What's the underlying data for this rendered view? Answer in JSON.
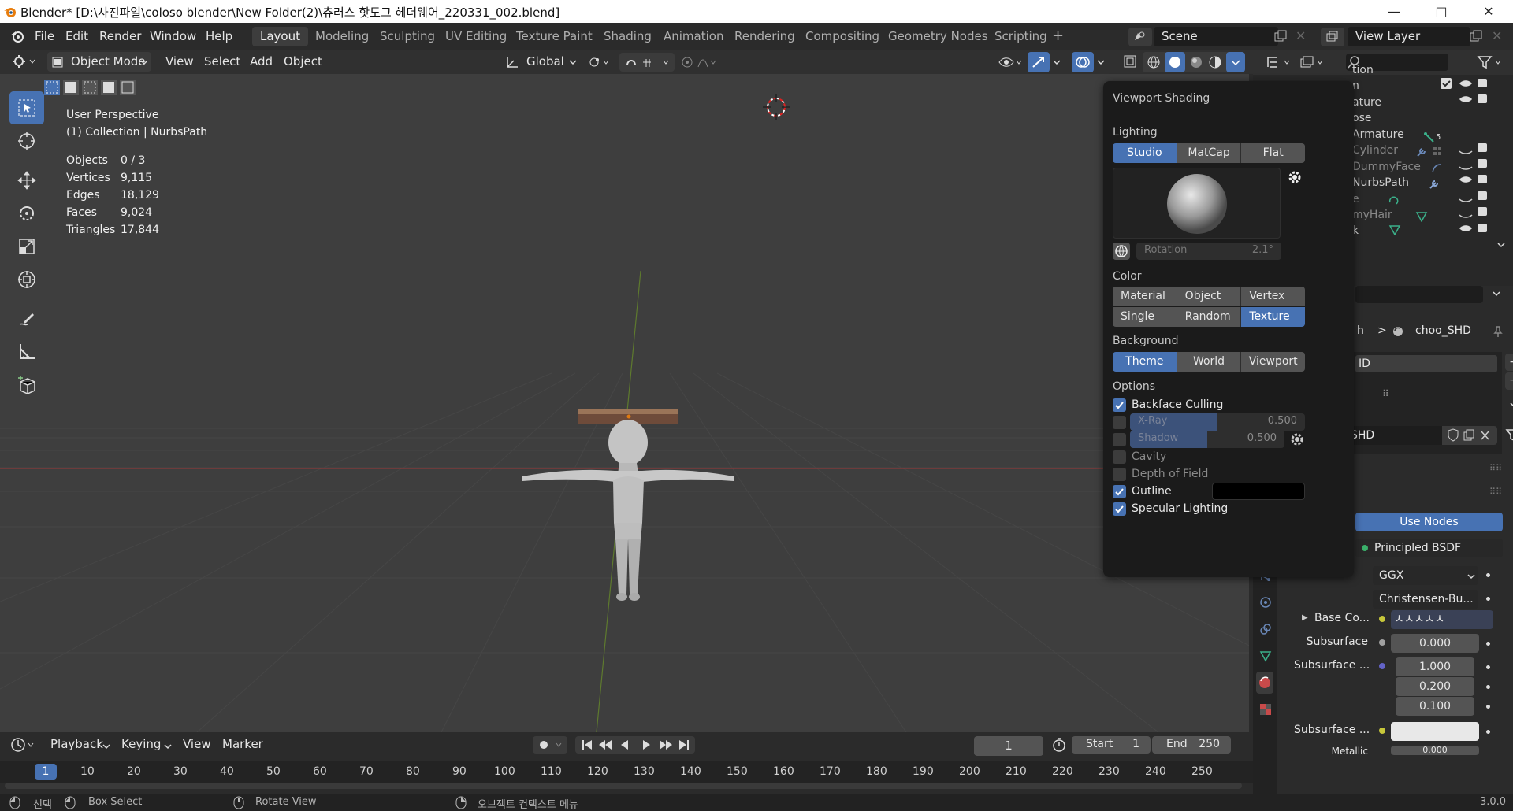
{
  "window": {
    "title": "Blender* [D:\\사진파일\\coloso blender\\New Folder(2)\\츄러스 핫도그 헤더웨어_220331_002.blend]",
    "minimize": "—",
    "maximize": "□",
    "close": "✕"
  },
  "menu": [
    "File",
    "Edit",
    "Render",
    "Window",
    "Help"
  ],
  "workspaces": [
    "Layout",
    "Modeling",
    "Sculpting",
    "UV Editing",
    "Texture Paint",
    "Shading",
    "Animation",
    "Rendering",
    "Compositing",
    "Geometry Nodes",
    "Scripting"
  ],
  "active_workspace": "Layout",
  "add_workspace": "+",
  "scene": "Scene",
  "view_layer": "View Layer",
  "header": {
    "mode": "Object Mode",
    "menus": [
      "View",
      "Select",
      "Add",
      "Object"
    ],
    "transform_orientation": "Global"
  },
  "viewport": {
    "view_name": "User Perspective",
    "collection": "(1) Collection | NurbsPath",
    "stats": [
      {
        "label": "Objects",
        "value": "0 / 3"
      },
      {
        "label": "Vertices",
        "value": "9,115"
      },
      {
        "label": "Edges",
        "value": "18,129"
      },
      {
        "label": "Faces",
        "value": "9,024"
      },
      {
        "label": "Triangles",
        "value": "17,844"
      }
    ]
  },
  "shading_popup": {
    "title": "Viewport Shading",
    "lighting_label": "Lighting",
    "lighting": [
      "Studio",
      "MatCap",
      "Flat"
    ],
    "lighting_active": "Studio",
    "rotation_label": "Rotation",
    "rotation_value": "2.1°",
    "color_label": "Color",
    "color_options": [
      "Material",
      "Object",
      "Vertex",
      "Single",
      "Random",
      "Texture"
    ],
    "color_active": "Texture",
    "background_label": "Background",
    "background": [
      "Theme",
      "World",
      "Viewport"
    ],
    "background_active": "Theme",
    "options_label": "Options",
    "backface_culling": "Backface Culling",
    "xray": "X-Ray",
    "xray_value": "0.500",
    "xray_fill": 0.5,
    "shadow": "Shadow",
    "shadow_value": "0.500",
    "shadow_fill": 0.5,
    "cavity": "Cavity",
    "depth_of_field": "Depth of Field",
    "outline": "Outline",
    "specular": "Specular Lighting"
  },
  "outliner": {
    "items": [
      {
        "label": "tion",
        "eye": false,
        "check": true
      },
      {
        "label": "n",
        "eye": true,
        "check": true
      },
      {
        "label": "ature",
        "eye": true
      },
      {
        "label": "ose",
        "eye": false
      },
      {
        "label": "Armature",
        "badge": "5",
        "eye": false
      },
      {
        "label": "Cylinder",
        "eye": false
      },
      {
        "label": "DummyFace",
        "eye": false
      },
      {
        "label": "NurbsPath",
        "eye": true
      },
      {
        "label": "e",
        "eye": false
      },
      {
        "label": "myHair",
        "eye": false
      },
      {
        "label": "k",
        "eye": true
      }
    ]
  },
  "properties": {
    "breadcrumb_h": "h",
    "breadcrumb_sep": ">",
    "material_name": "choo_SHD",
    "slot_partial": "ID",
    "datablock_partial": "SHD",
    "use_nodes": "Use Nodes",
    "surface_partial": "e",
    "surface_shader": "Principled BSDF",
    "distribution": "GGX",
    "subsurface_method": "Christensen-Bu...",
    "base_color_label": "Base Co...",
    "base_color_value": "ㅊㅊㅊㅊㅊ",
    "subsurface_label": "Subsurface",
    "subsurface_value": "0.000",
    "subsurface_radius_label": "Subsurface ...",
    "subsurface_radius": [
      "1.000",
      "0.200",
      "0.100"
    ],
    "subsurface_color_label": "Subsurface ...",
    "metallic_label": "Metallic",
    "metallic_value": "0.000"
  },
  "timeline": {
    "menus": [
      "Playback",
      "Keying",
      "View",
      "Marker"
    ],
    "current_frame": "1",
    "start_label": "Start",
    "start": "1",
    "end_label": "End",
    "end": "250",
    "ruler": [
      "1",
      "10",
      "20",
      "30",
      "40",
      "50",
      "60",
      "70",
      "80",
      "90",
      "100",
      "110",
      "120",
      "130",
      "140",
      "150",
      "160",
      "170",
      "180",
      "190",
      "200",
      "210",
      "220",
      "230",
      "240",
      "250"
    ]
  },
  "status": {
    "select": "선택",
    "box_select": "Box Select",
    "rotate_view": "Rotate View",
    "context_menu": "오브젝트 컨텍스트 메뉴",
    "version": "3.0.0"
  },
  "colors": {
    "accent": "#4772b3",
    "viewport_bg": "#3e3e3e",
    "popup_bg": "#1b1b1b"
  }
}
